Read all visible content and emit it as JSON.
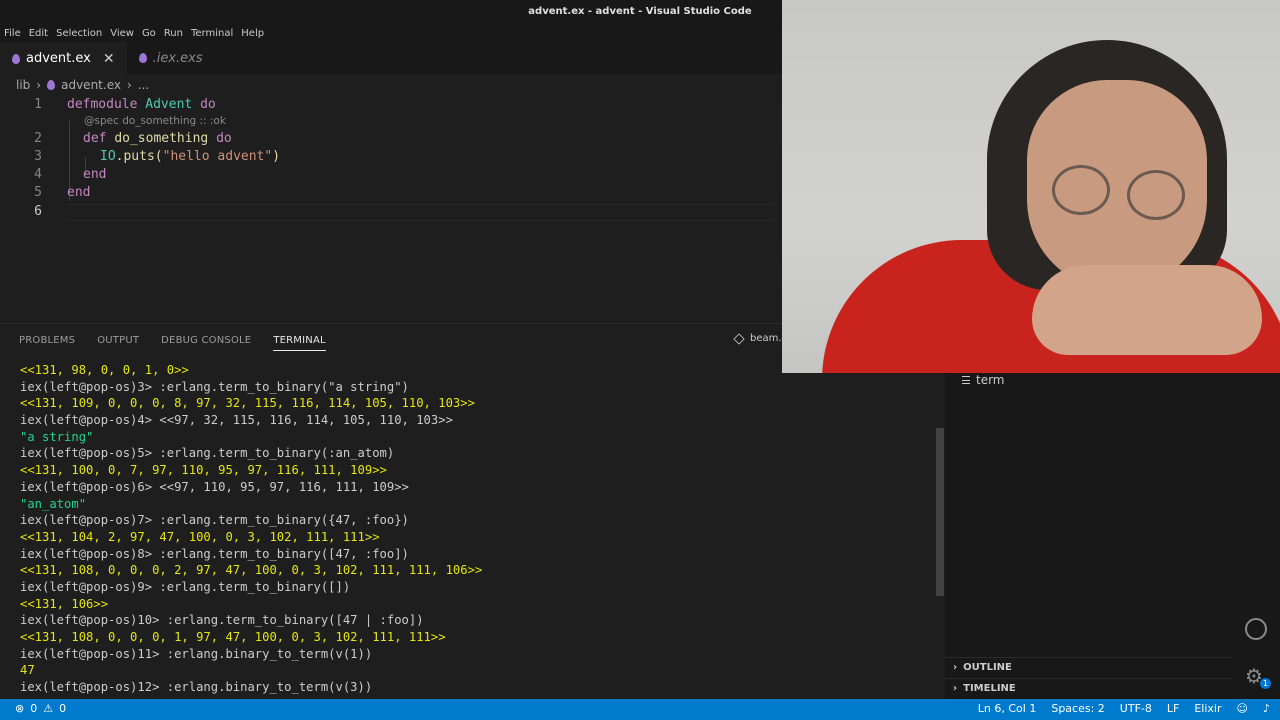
{
  "window": {
    "title": "advent.ex - advent - Visual Studio Code"
  },
  "menu": [
    "File",
    "Edit",
    "Selection",
    "View",
    "Go",
    "Run",
    "Terminal",
    "Help"
  ],
  "tabs": [
    {
      "label": "advent.ex",
      "active": true
    },
    {
      "label": ".iex.exs",
      "active": false
    }
  ],
  "breadcrumb": {
    "folder": "lib",
    "file": "advent.ex",
    "more": "..."
  },
  "editor": {
    "line_numbers": [
      "1",
      "2",
      "3",
      "4",
      "5",
      "6"
    ],
    "hint": "@spec do_something :: :ok",
    "lines": {
      "l1_kw": "defmodule",
      "l1_mod": "Advent",
      "l1_do": "do",
      "l2_kw": "def",
      "l2_fn": "do_something",
      "l2_do": "do",
      "l3_mod": "IO",
      "l3_fn": ".puts(",
      "l3_str": "\"hello advent\"",
      "l3_close": ")",
      "l4_end": "end",
      "l5_end": "end"
    }
  },
  "panel": {
    "tabs": [
      "PROBLEMS",
      "OUTPUT",
      "DEBUG CONSOLE",
      "TERMINAL"
    ],
    "active_tab": "TERMINAL",
    "terminal_name": "beam."
  },
  "terminal_lines": [
    {
      "text": "<<131, 98, 0, 0, 1, 0>>",
      "color": "yellow"
    },
    {
      "text": "iex(left@pop-os)3> :erlang.term_to_binary(\"a string\")",
      "color": "normal"
    },
    {
      "text": "<<131, 109, 0, 0, 0, 8, 97, 32, 115, 116, 114, 105, 110, 103>>",
      "color": "yellow"
    },
    {
      "text": "iex(left@pop-os)4> <<97, 32, 115, 116, 114, 105, 110, 103>>",
      "color": "normal"
    },
    {
      "text": "\"a string\"",
      "color": "green"
    },
    {
      "text": "iex(left@pop-os)5> :erlang.term_to_binary(:an_atom)",
      "color": "normal"
    },
    {
      "text": "<<131, 100, 0, 7, 97, 110, 95, 97, 116, 111, 109>>",
      "color": "yellow"
    },
    {
      "text": "iex(left@pop-os)6> <<97, 110, 95, 97, 116, 111, 109>>",
      "color": "normal"
    },
    {
      "text": "\"an_atom\"",
      "color": "green"
    },
    {
      "text": "iex(left@pop-os)7> :erlang.term_to_binary({47, :foo})",
      "color": "normal"
    },
    {
      "text": "<<131, 104, 2, 97, 47, 100, 0, 3, 102, 111, 111>>",
      "color": "yellow"
    },
    {
      "text": "iex(left@pop-os)8> :erlang.term_to_binary([47, :foo])",
      "color": "normal"
    },
    {
      "text": "<<131, 108, 0, 0, 0, 2, 97, 47, 100, 0, 3, 102, 111, 111, 106>>",
      "color": "yellow"
    },
    {
      "text": "iex(left@pop-os)9> :erlang.term_to_binary([])",
      "color": "normal"
    },
    {
      "text": "<<131, 106>>",
      "color": "yellow"
    },
    {
      "text": "iex(left@pop-os)10> :erlang.term_to_binary([47 | :foo])",
      "color": "normal"
    },
    {
      "text": "<<131, 108, 0, 0, 0, 1, 97, 47, 100, 0, 3, 102, 111, 111>>",
      "color": "yellow"
    },
    {
      "text": "iex(left@pop-os)11> :erlang.binary_to_term(v(1))",
      "color": "normal"
    },
    {
      "text": "47",
      "color": "yellow"
    },
    {
      "text": "iex(left@pop-os)12> :erlang.binary_to_term(v(3))",
      "color": "normal"
    }
  ],
  "sidepanel": {
    "terminal_item": "term",
    "outline": "OUTLINE",
    "timeline": "TIMELINE",
    "settings_badge": "1"
  },
  "statusbar": {
    "errors": "0",
    "warnings": "0",
    "position": "Ln 6, Col 1",
    "spaces": "Spaces: 2",
    "encoding": "UTF-8",
    "eol": "LF",
    "language": "Elixir"
  },
  "colors": {
    "statusbar_bg": "#007acc",
    "terminal_yellow": "#e5e510",
    "terminal_green": "#23d18b",
    "elixir_icon": "#9d76d4"
  }
}
